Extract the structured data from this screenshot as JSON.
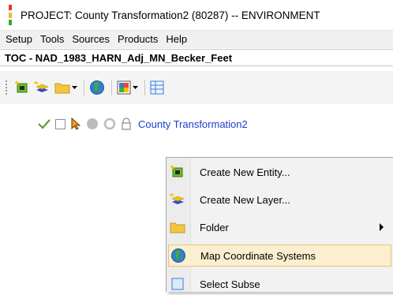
{
  "window": {
    "title": "PROJECT:  County Transformation2 (80287)  --  ENVIRONMENT",
    "title_color": "#000000"
  },
  "menubar": {
    "items": [
      {
        "label": "Setup"
      },
      {
        "label": "Tools"
      },
      {
        "label": "Sources"
      },
      {
        "label": "Products"
      },
      {
        "label": "Help"
      }
    ]
  },
  "toc": {
    "label": "TOC - NAD_1983_HARN_Adj_MN_Becker_Feet"
  },
  "toolbar": {
    "icons": [
      "new-entity-icon",
      "new-layer-icon",
      "folder-icon",
      "globe-icon",
      "raster-icon",
      "table-icon"
    ]
  },
  "tree": {
    "project_label": "County Transformation2",
    "label_color": "#1a40c8",
    "check_color": "#5aa02c"
  },
  "context_menu": {
    "items": [
      {
        "label": "Create New Entity...",
        "icon": "new-entity-icon"
      },
      {
        "label": "Create New Layer...",
        "icon": "new-layer-icon"
      },
      {
        "label": "Folder",
        "icon": "folder-icon",
        "has_submenu": true
      },
      {
        "label": "Map Coordinate Systems",
        "icon": "globe-icon",
        "highlighted": true
      },
      {
        "label": "Select Subse",
        "icon": "select-icon"
      }
    ],
    "highlight_color": "#fbefcf"
  }
}
